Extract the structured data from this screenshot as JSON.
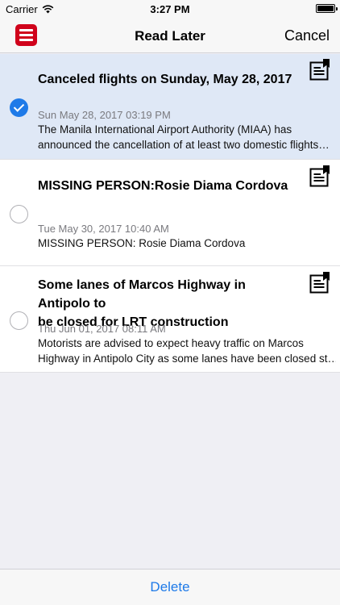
{
  "status_bar": {
    "carrier": "Carrier",
    "time": "3:27 PM"
  },
  "nav": {
    "title": "Read Later",
    "cancel_label": "Cancel"
  },
  "articles": [
    {
      "title": "Canceled flights on Sunday, May 28, 2017",
      "date": "Sun May 28, 2017 03:19 PM",
      "summary_line1": "The Manila International Airport Authority (MIAA) has",
      "summary_line2": "announced the cancellation of at least two domestic flights…",
      "selected": true
    },
    {
      "title": "MISSING PERSON:Rosie Diama Cordova",
      "date": "Tue May 30, 2017 10:40 AM",
      "summary_line1": "MISSING PERSON: Rosie Diama Cordova",
      "selected": false
    },
    {
      "title_line1": "Some lanes of Marcos Highway in Antipolo to",
      "title_line2": "be closed for LRT construction",
      "date": "Thu Jun 01, 2017 08:11 AM",
      "summary_line1": "Motorists are advised to expect heavy traffic on Marcos",
      "summary_line2": "Highway in Antipolo City as some lanes have been closed st…",
      "selected": false
    }
  ],
  "toolbar": {
    "delete_label": "Delete"
  },
  "colors": {
    "accent": "#1e7ae8",
    "menu_button": "#d0021b",
    "selected_row": "#dfe8f6"
  },
  "icons": {
    "menu": "hamburger-menu-icon",
    "wifi": "wifi-icon",
    "battery": "battery-icon",
    "article": "article-bookmark-icon",
    "checkmark": "checkmark-icon"
  }
}
